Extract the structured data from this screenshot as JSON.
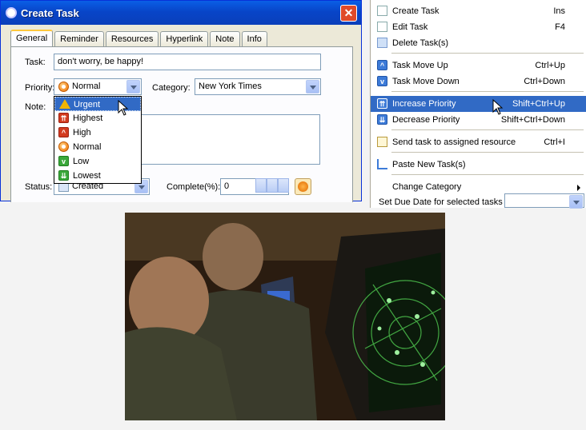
{
  "dialog": {
    "title": "Create Task",
    "close_glyph": "✕",
    "tabs": [
      "General",
      "Reminder",
      "Resources",
      "Hyperlink",
      "Note",
      "Info"
    ],
    "task_label": "Task:",
    "task_value": "don't worry, be happy!",
    "priority_label": "Priority:",
    "priority_value": "Normal",
    "category_label": "Category:",
    "category_value": "New York Times",
    "note_label": "Note:",
    "status_label": "Status:",
    "status_value": "Created",
    "complete_label": "Complete(%):",
    "complete_value": "0",
    "priority_options": [
      {
        "label": "Urgent",
        "icon": "warning-icon"
      },
      {
        "label": "Highest",
        "icon": "double-up-arrow-icon"
      },
      {
        "label": "High",
        "icon": "up-arrow-icon"
      },
      {
        "label": "Normal",
        "icon": "normal-circle-icon"
      },
      {
        "label": "Low",
        "icon": "down-arrow-icon"
      },
      {
        "label": "Lowest",
        "icon": "double-down-arrow-icon"
      }
    ]
  },
  "menu": {
    "items": [
      {
        "label": "Create Task",
        "shortcut": "Ins",
        "icon": "create-task-icon"
      },
      {
        "label": "Edit Task",
        "shortcut": "F4",
        "icon": "edit-task-icon"
      },
      {
        "label": "Delete Task(s)",
        "shortcut": "",
        "icon": "delete-task-icon"
      },
      {
        "label": "Task Move Up",
        "shortcut": "Ctrl+Up",
        "icon": "move-up-icon"
      },
      {
        "label": "Task Move Down",
        "shortcut": "Ctrl+Down",
        "icon": "move-down-icon"
      },
      {
        "label": "Increase Priority",
        "shortcut": "Shift+Ctrl+Up",
        "icon": "increase-priority-icon"
      },
      {
        "label": "Decrease Priority",
        "shortcut": "Shift+Ctrl+Down",
        "icon": "decrease-priority-icon"
      },
      {
        "label": "Send task to assigned resource",
        "shortcut": "Ctrl+I",
        "icon": "send-task-icon"
      },
      {
        "label": "Paste New Task(s)",
        "shortcut": "",
        "icon": "paste-task-icon"
      },
      {
        "label": "Change Category",
        "shortcut": "",
        "icon": ""
      },
      {
        "label": "Set Due Date for selected tasks",
        "shortcut": "",
        "icon": ""
      }
    ]
  },
  "photo": {
    "description_icon": "radar-console-photo"
  },
  "colors": {
    "selection": "#316ac5",
    "titlebar": "#0a5fe6"
  }
}
